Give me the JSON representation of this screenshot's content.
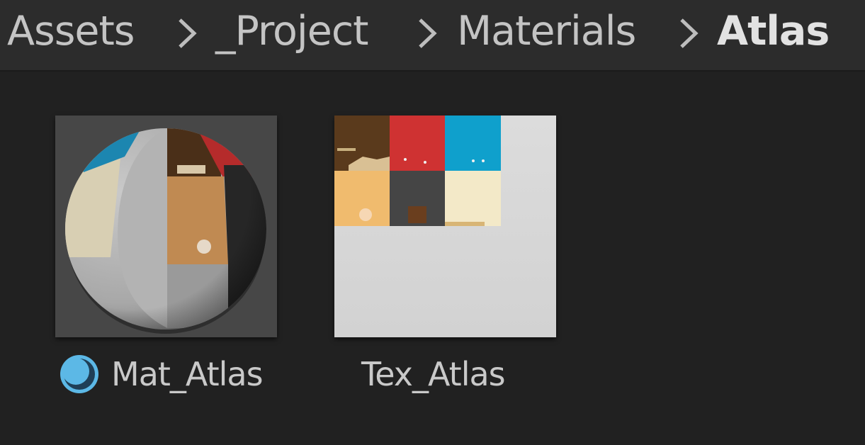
{
  "breadcrumb": {
    "items": [
      "Assets",
      "_Project",
      "Materials",
      "Atlas"
    ]
  },
  "assets": [
    {
      "name": "Mat_Atlas",
      "type_icon": "material-sphere-icon"
    },
    {
      "name": "Tex_Atlas",
      "type_icon": ""
    }
  ],
  "colors": {
    "background": "#212121",
    "breadcrumb_bar": "#2c2c2c",
    "accent_icon": "#5cb8e6",
    "atlas_tiles": [
      "#5a3a1c",
      "#cf3232",
      "#0fa0cc",
      "#f0bb6e",
      "#454545",
      "#f3e9c8"
    ]
  }
}
